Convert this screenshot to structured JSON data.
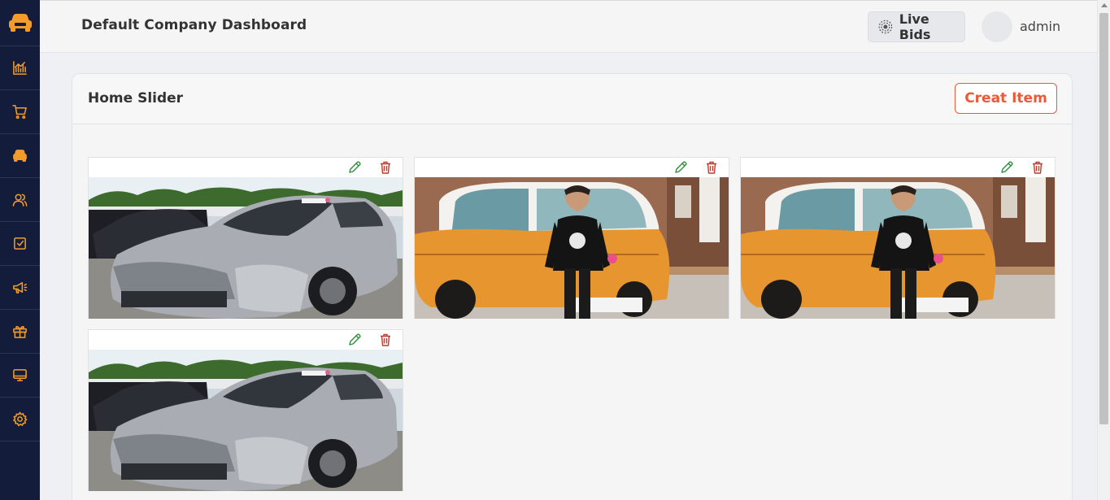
{
  "header": {
    "title": "Default Company Dashboard",
    "live_bids_label": "Live Bids",
    "user_name": "admin"
  },
  "sidebar": {
    "items": [
      {
        "icon": "chart-icon"
      },
      {
        "icon": "cart-icon"
      },
      {
        "icon": "car-icon"
      },
      {
        "icon": "users-icon"
      },
      {
        "icon": "checklist-icon"
      },
      {
        "icon": "megaphone-icon"
      },
      {
        "icon": "gift-icon"
      },
      {
        "icon": "monitor-icon"
      },
      {
        "icon": "gear-icon"
      }
    ]
  },
  "card": {
    "title": "Home Slider",
    "create_label": "Creat Item"
  },
  "slider_items": [
    {
      "image": "damaged-silver-sedan-photo"
    },
    {
      "image": "boy-with-orange-car-photo"
    },
    {
      "image": "boy-with-orange-car-photo"
    },
    {
      "image": "damaged-silver-sedan-photo"
    }
  ],
  "colors": {
    "sidebar_bg": "#131c3a",
    "sidebar_icon": "#f39c2b",
    "accent": "#ea5a3a",
    "edit_icon": "#2e8b3a",
    "delete_icon": "#c0392b"
  }
}
